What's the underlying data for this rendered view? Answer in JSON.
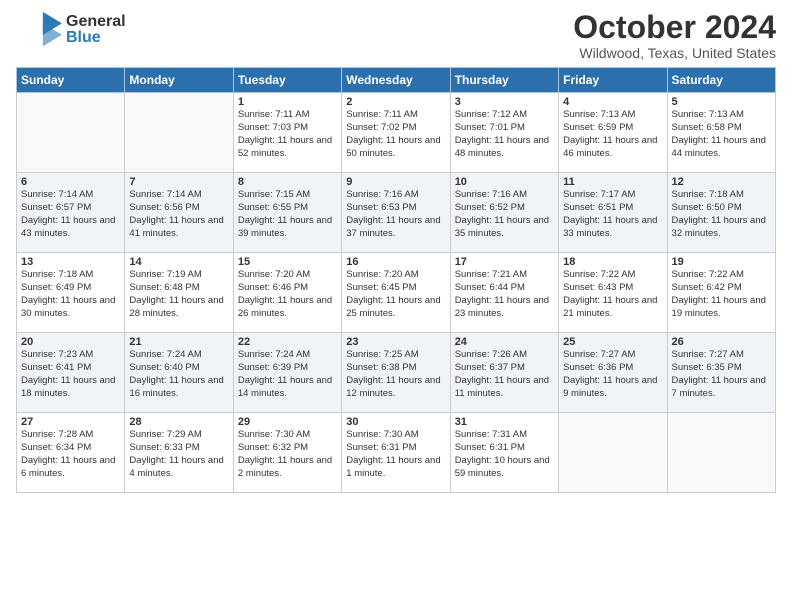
{
  "header": {
    "title": "October 2024",
    "subtitle": "Wildwood, Texas, United States",
    "logo_general": "General",
    "logo_blue": "Blue"
  },
  "days": [
    "Sunday",
    "Monday",
    "Tuesday",
    "Wednesday",
    "Thursday",
    "Friday",
    "Saturday"
  ],
  "weeks": [
    [
      {
        "day": "",
        "sunrise": "",
        "sunset": "",
        "daylight": ""
      },
      {
        "day": "",
        "sunrise": "",
        "sunset": "",
        "daylight": ""
      },
      {
        "day": "1",
        "sunrise": "Sunrise: 7:11 AM",
        "sunset": "Sunset: 7:03 PM",
        "daylight": "Daylight: 11 hours and 52 minutes."
      },
      {
        "day": "2",
        "sunrise": "Sunrise: 7:11 AM",
        "sunset": "Sunset: 7:02 PM",
        "daylight": "Daylight: 11 hours and 50 minutes."
      },
      {
        "day": "3",
        "sunrise": "Sunrise: 7:12 AM",
        "sunset": "Sunset: 7:01 PM",
        "daylight": "Daylight: 11 hours and 48 minutes."
      },
      {
        "day": "4",
        "sunrise": "Sunrise: 7:13 AM",
        "sunset": "Sunset: 6:59 PM",
        "daylight": "Daylight: 11 hours and 46 minutes."
      },
      {
        "day": "5",
        "sunrise": "Sunrise: 7:13 AM",
        "sunset": "Sunset: 6:58 PM",
        "daylight": "Daylight: 11 hours and 44 minutes."
      }
    ],
    [
      {
        "day": "6",
        "sunrise": "Sunrise: 7:14 AM",
        "sunset": "Sunset: 6:57 PM",
        "daylight": "Daylight: 11 hours and 43 minutes."
      },
      {
        "day": "7",
        "sunrise": "Sunrise: 7:14 AM",
        "sunset": "Sunset: 6:56 PM",
        "daylight": "Daylight: 11 hours and 41 minutes."
      },
      {
        "day": "8",
        "sunrise": "Sunrise: 7:15 AM",
        "sunset": "Sunset: 6:55 PM",
        "daylight": "Daylight: 11 hours and 39 minutes."
      },
      {
        "day": "9",
        "sunrise": "Sunrise: 7:16 AM",
        "sunset": "Sunset: 6:53 PM",
        "daylight": "Daylight: 11 hours and 37 minutes."
      },
      {
        "day": "10",
        "sunrise": "Sunrise: 7:16 AM",
        "sunset": "Sunset: 6:52 PM",
        "daylight": "Daylight: 11 hours and 35 minutes."
      },
      {
        "day": "11",
        "sunrise": "Sunrise: 7:17 AM",
        "sunset": "Sunset: 6:51 PM",
        "daylight": "Daylight: 11 hours and 33 minutes."
      },
      {
        "day": "12",
        "sunrise": "Sunrise: 7:18 AM",
        "sunset": "Sunset: 6:50 PM",
        "daylight": "Daylight: 11 hours and 32 minutes."
      }
    ],
    [
      {
        "day": "13",
        "sunrise": "Sunrise: 7:18 AM",
        "sunset": "Sunset: 6:49 PM",
        "daylight": "Daylight: 11 hours and 30 minutes."
      },
      {
        "day": "14",
        "sunrise": "Sunrise: 7:19 AM",
        "sunset": "Sunset: 6:48 PM",
        "daylight": "Daylight: 11 hours and 28 minutes."
      },
      {
        "day": "15",
        "sunrise": "Sunrise: 7:20 AM",
        "sunset": "Sunset: 6:46 PM",
        "daylight": "Daylight: 11 hours and 26 minutes."
      },
      {
        "day": "16",
        "sunrise": "Sunrise: 7:20 AM",
        "sunset": "Sunset: 6:45 PM",
        "daylight": "Daylight: 11 hours and 25 minutes."
      },
      {
        "day": "17",
        "sunrise": "Sunrise: 7:21 AM",
        "sunset": "Sunset: 6:44 PM",
        "daylight": "Daylight: 11 hours and 23 minutes."
      },
      {
        "day": "18",
        "sunrise": "Sunrise: 7:22 AM",
        "sunset": "Sunset: 6:43 PM",
        "daylight": "Daylight: 11 hours and 21 minutes."
      },
      {
        "day": "19",
        "sunrise": "Sunrise: 7:22 AM",
        "sunset": "Sunset: 6:42 PM",
        "daylight": "Daylight: 11 hours and 19 minutes."
      }
    ],
    [
      {
        "day": "20",
        "sunrise": "Sunrise: 7:23 AM",
        "sunset": "Sunset: 6:41 PM",
        "daylight": "Daylight: 11 hours and 18 minutes."
      },
      {
        "day": "21",
        "sunrise": "Sunrise: 7:24 AM",
        "sunset": "Sunset: 6:40 PM",
        "daylight": "Daylight: 11 hours and 16 minutes."
      },
      {
        "day": "22",
        "sunrise": "Sunrise: 7:24 AM",
        "sunset": "Sunset: 6:39 PM",
        "daylight": "Daylight: 11 hours and 14 minutes."
      },
      {
        "day": "23",
        "sunrise": "Sunrise: 7:25 AM",
        "sunset": "Sunset: 6:38 PM",
        "daylight": "Daylight: 11 hours and 12 minutes."
      },
      {
        "day": "24",
        "sunrise": "Sunrise: 7:26 AM",
        "sunset": "Sunset: 6:37 PM",
        "daylight": "Daylight: 11 hours and 11 minutes."
      },
      {
        "day": "25",
        "sunrise": "Sunrise: 7:27 AM",
        "sunset": "Sunset: 6:36 PM",
        "daylight": "Daylight: 11 hours and 9 minutes."
      },
      {
        "day": "26",
        "sunrise": "Sunrise: 7:27 AM",
        "sunset": "Sunset: 6:35 PM",
        "daylight": "Daylight: 11 hours and 7 minutes."
      }
    ],
    [
      {
        "day": "27",
        "sunrise": "Sunrise: 7:28 AM",
        "sunset": "Sunset: 6:34 PM",
        "daylight": "Daylight: 11 hours and 6 minutes."
      },
      {
        "day": "28",
        "sunrise": "Sunrise: 7:29 AM",
        "sunset": "Sunset: 6:33 PM",
        "daylight": "Daylight: 11 hours and 4 minutes."
      },
      {
        "day": "29",
        "sunrise": "Sunrise: 7:30 AM",
        "sunset": "Sunset: 6:32 PM",
        "daylight": "Daylight: 11 hours and 2 minutes."
      },
      {
        "day": "30",
        "sunrise": "Sunrise: 7:30 AM",
        "sunset": "Sunset: 6:31 PM",
        "daylight": "Daylight: 11 hours and 1 minute."
      },
      {
        "day": "31",
        "sunrise": "Sunrise: 7:31 AM",
        "sunset": "Sunset: 6:31 PM",
        "daylight": "Daylight: 10 hours and 59 minutes."
      },
      {
        "day": "",
        "sunrise": "",
        "sunset": "",
        "daylight": ""
      },
      {
        "day": "",
        "sunrise": "",
        "sunset": "",
        "daylight": ""
      }
    ]
  ]
}
